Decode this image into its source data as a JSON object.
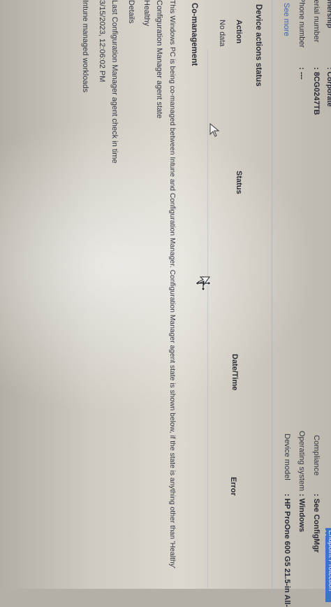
{
  "essentials_left": {
    "ownership_label": "Ownership",
    "ownership_value": ": Corporate",
    "serial_label": "Serial number",
    "serial_value": ": 8CG0247TB",
    "phone_label": "Phone number",
    "phone_value": ": ---",
    "see_more": "See more"
  },
  "essentials_right": {
    "compliance_label": "Compliance",
    "compliance_value": ": See ConfigMgr",
    "os_label": "Operating system",
    "os_value": ": Windows",
    "model_label": "Device model",
    "model_value": ": HP ProOne 600 G5 21.5-in All-",
    "top_bar_text": "Endpoint Protection Ma..."
  },
  "device_actions": {
    "title": "Device actions status",
    "columns": [
      "Action",
      "Status",
      "Date/Time",
      "Error"
    ],
    "empty_text": "No data"
  },
  "co_management": {
    "title": "Co-management",
    "description": "This Windows PC is being co-managed between Intune and Configuration Manager. Configuration Manager agent state is shown below, if the state is anything other than 'Healthy'",
    "agent_state_label": "Configuration Manager agent state",
    "agent_state_value": "Healthy",
    "details_label": "Details",
    "checkin_label": "Last Configuration Manager agent check in time",
    "checkin_value": "3/15/2023, 12:06:02 PM",
    "workloads_label": "Intune managed workloads"
  },
  "colors": {
    "link": "#3f63b5",
    "text": "#2c2e3a",
    "accent_bar": "#3c74c8"
  }
}
